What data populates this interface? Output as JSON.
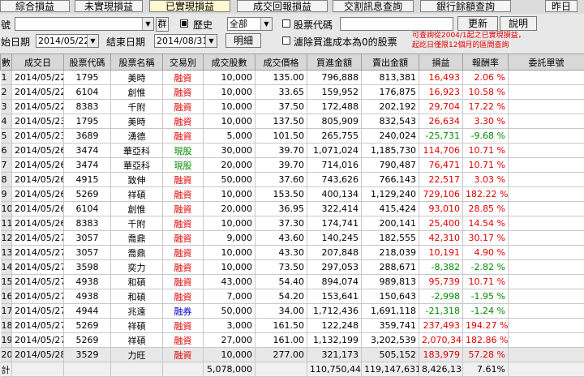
{
  "tabs": [
    "綜合損益",
    "未實現損益",
    "已實現損益",
    "成交回報損益",
    "交割訊息查詢",
    "銀行餘額查詢",
    "昨日"
  ],
  "active_tab": 2,
  "filters": {
    "account_label": "號",
    "account_value": "",
    "group_button": "群",
    "history_label": "歷史",
    "history_checked": true,
    "type_value": "全部",
    "stock_code_label": "股票代碼",
    "stock_code_checked": false,
    "stock_code_value": "",
    "update_button": "更新",
    "help_button": "說明",
    "start_label": "始日期",
    "start_date": "2014/05/22",
    "end_label": "結束日期",
    "end_date": "2014/08/31",
    "detail_button": "明細",
    "filter_zero_label": "濾除買進成本為0的股票",
    "filter_zero_checked": false,
    "note_line1": "可查詢從2004/1起之已實現損益，",
    "note_line2": "起訖日僅限12個月的區間查詢"
  },
  "columns": [
    "數",
    "成交日",
    "股票代碼",
    "股票名稱",
    "交易別",
    "成交股數",
    "成交價格",
    "買進金額",
    "賣出金額",
    "損益",
    "報酬率",
    "委託單號"
  ],
  "rows": [
    [
      "1",
      "2014/05/22",
      "1795",
      "美時",
      "融資",
      "10,000",
      "135.00",
      "796,888",
      "813,381",
      "16,493",
      "2.06 %",
      ""
    ],
    [
      "2",
      "2014/05/22",
      "6104",
      "創惟",
      "融資",
      "10,000",
      "33.65",
      "159,952",
      "176,875",
      "16,923",
      "10.58 %",
      ""
    ],
    [
      "3",
      "2014/05/22",
      "8383",
      "千附",
      "融資",
      "10,000",
      "37.50",
      "172,488",
      "202,192",
      "29,704",
      "17.22 %",
      ""
    ],
    [
      "4",
      "2014/05/23",
      "1795",
      "美時",
      "融資",
      "10,000",
      "137.50",
      "805,909",
      "832,543",
      "26,634",
      "3.30 %",
      ""
    ],
    [
      "5",
      "2014/05/23",
      "3689",
      "湧德",
      "融資",
      "5,000",
      "101.50",
      "265,755",
      "240,024",
      "-25,731",
      "-9.68 %",
      ""
    ],
    [
      "6",
      "2014/05/26",
      "3474",
      "華亞科",
      "現股",
      "30,000",
      "39.70",
      "1,071,024",
      "1,185,730",
      "114,706",
      "10.71 %",
      ""
    ],
    [
      "7",
      "2014/05/26",
      "3474",
      "華亞科",
      "現股",
      "20,000",
      "39.70",
      "714,016",
      "790,487",
      "76,471",
      "10.71 %",
      ""
    ],
    [
      "8",
      "2014/05/26",
      "4915",
      "致伸",
      "融資",
      "50,000",
      "37.60",
      "743,626",
      "766,143",
      "22,517",
      "3.03 %",
      ""
    ],
    [
      "9",
      "2014/05/26",
      "5269",
      "祥碩",
      "融資",
      "10,000",
      "153.50",
      "400,134",
      "1,129,240",
      "729,106",
      "182.22 %",
      ""
    ],
    [
      "10",
      "2014/05/26",
      "6104",
      "創惟",
      "融資",
      "20,000",
      "36.95",
      "322,414",
      "415,424",
      "93,010",
      "28.85 %",
      ""
    ],
    [
      "11",
      "2014/05/26",
      "8383",
      "千附",
      "融資",
      "10,000",
      "37.30",
      "174,741",
      "200,141",
      "25,400",
      "14.54 %",
      ""
    ],
    [
      "12",
      "2014/05/27",
      "3057",
      "喬鼎",
      "融資",
      "9,000",
      "43.60",
      "140,245",
      "182,555",
      "42,310",
      "30.17 %",
      ""
    ],
    [
      "13",
      "2014/05/27",
      "3057",
      "喬鼎",
      "融資",
      "10,000",
      "43.30",
      "207,848",
      "218,039",
      "10,191",
      "4.90 %",
      ""
    ],
    [
      "14",
      "2014/05/27",
      "3598",
      "奕力",
      "融資",
      "10,000",
      "73.50",
      "297,053",
      "288,671",
      "-8,382",
      "-2.82 %",
      ""
    ],
    [
      "15",
      "2014/05/27",
      "4938",
      "和碩",
      "融資",
      "43,000",
      "54.40",
      "894,074",
      "989,813",
      "95,739",
      "10.71 %",
      ""
    ],
    [
      "16",
      "2014/05/27",
      "4938",
      "和碩",
      "融資",
      "7,000",
      "54.20",
      "153,641",
      "150,643",
      "-2,998",
      "-1.95 %",
      ""
    ],
    [
      "17",
      "2014/05/27",
      "4944",
      "兆遠",
      "融券",
      "50,000",
      "34.00",
      "1,712,436",
      "1,691,118",
      "-21,318",
      "-1.24 %",
      ""
    ],
    [
      "18",
      "2014/05/27",
      "5269",
      "祥碩",
      "融資",
      "3,000",
      "161.50",
      "122,248",
      "359,741",
      "237,493",
      "194.27 %",
      ""
    ],
    [
      "19",
      "2014/05/27",
      "5269",
      "祥碩",
      "融資",
      "27,000",
      "161.00",
      "1,132,199",
      "3,202,539",
      "2,070,340",
      "182.86 %",
      ""
    ],
    [
      "20",
      "2014/05/28",
      "3529",
      "力旺",
      "融資",
      "10,000",
      "277.00",
      "321,173",
      "505,152",
      "183,979",
      "57.28 %",
      ""
    ]
  ],
  "totals": {
    "label": "計",
    "shares": "5,078,000",
    "buy": "110,750,443",
    "sell": "119,147,631",
    "pnl": "8,426,136",
    "rate": "7.61%"
  },
  "colors": {
    "gain": "#e00000",
    "loss": "#008a00",
    "cash": "#008a00",
    "margin": "#e00000",
    "short": "#0000cc"
  }
}
